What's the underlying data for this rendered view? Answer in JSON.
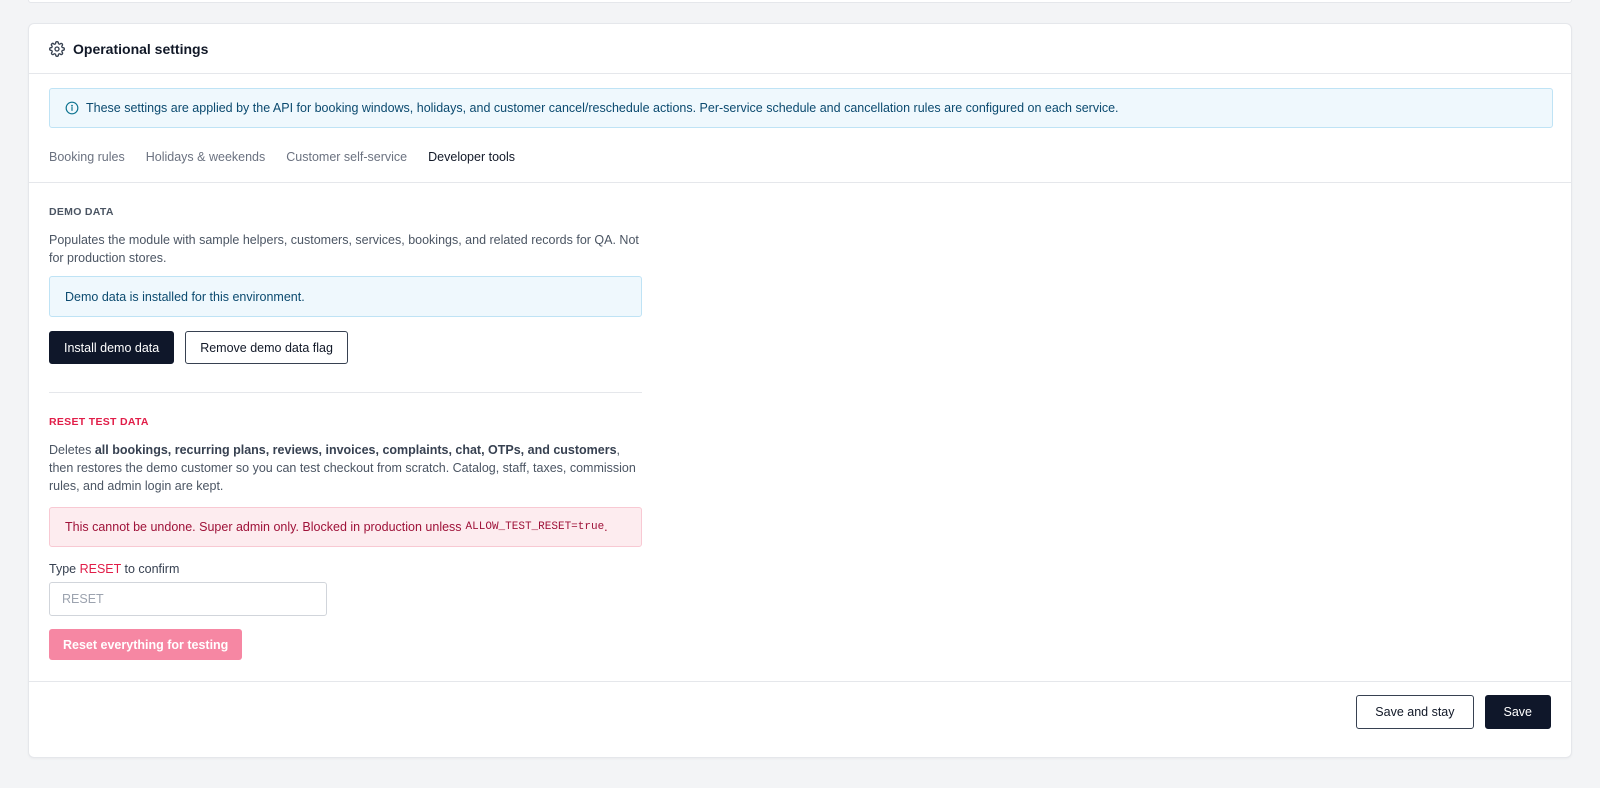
{
  "header": {
    "title": "Operational settings",
    "icon": "gear-icon"
  },
  "info_banner": {
    "icon": "info-icon",
    "text": "These settings are applied by the API for booking windows, holidays, and customer cancel/reschedule actions. Per-service schedule and cancellation rules are configured on each service."
  },
  "tabs": [
    {
      "label": "Booking rules",
      "active": false
    },
    {
      "label": "Holidays & weekends",
      "active": false
    },
    {
      "label": "Customer self-service",
      "active": false
    },
    {
      "label": "Developer tools",
      "active": true
    }
  ],
  "demo_data": {
    "heading": "DEMO DATA",
    "description": "Populates the module with sample helpers, customers, services, bookings, and related records for QA. Not for production stores.",
    "notice": "Demo data is installed for this environment.",
    "install_button": "Install demo data",
    "remove_button": "Remove demo data flag"
  },
  "reset": {
    "heading": "RESET TEST DATA",
    "desc_prefix": "Deletes ",
    "desc_bold": "all bookings, recurring plans, reviews, invoices, complaints, chat, OTPs, and customers",
    "desc_suffix": ", then restores the demo customer so you can test checkout from scratch. Catalog, staff, taxes, commission rules, and admin login are kept.",
    "warning_text": "This cannot be undone. Super admin only. Blocked in production unless",
    "warning_code": "ALLOW_TEST_RESET=true",
    "warning_end": ".",
    "confirm_prefix": "Type ",
    "confirm_keyword": "RESET",
    "confirm_suffix": " to confirm",
    "input_value": "",
    "input_placeholder": "RESET",
    "reset_button": "Reset everything for testing"
  },
  "footer": {
    "save_and_stay": "Save and stay",
    "save": "Save"
  },
  "colors": {
    "primary_dark": "#0f172a",
    "danger": "#e11d48",
    "danger_button_disabled": "#f687a3",
    "info_bg": "#eff8fd"
  }
}
